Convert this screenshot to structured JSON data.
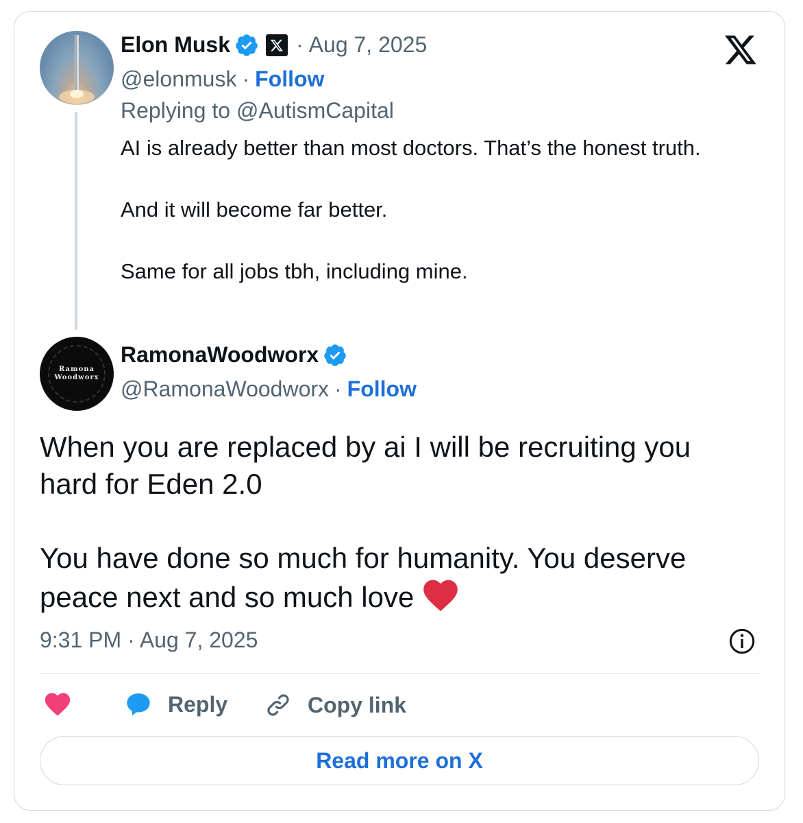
{
  "colors": {
    "link": "#1d6fd8",
    "muted": "#536471",
    "text": "#0f1419",
    "border": "#cfd9de",
    "heart": "#f0407a",
    "verified": "#1d9bf0"
  },
  "parent_tweet": {
    "display_name": "Elon Musk",
    "verified_icon": "verified-badge-icon",
    "affiliate_icon": "x-affiliate-icon",
    "separator": "·",
    "date": "Aug 7, 2025",
    "handle": "@elonmusk",
    "handle_sep": "·",
    "follow_label": "Follow",
    "replying_to": "Replying to @AutismCapital",
    "paragraphs": [
      "AI is already better than most doctors. That’s the honest truth.",
      "And it will become far better.",
      "Same for all jobs tbh, including mine."
    ]
  },
  "brand_icon": "x-logo-icon",
  "reply_tweet": {
    "display_name": "RamonaWoodworx",
    "verified_icon": "verified-badge-icon",
    "handle": "@RamonaWoodworx",
    "handle_sep": "·",
    "follow_label": "Follow",
    "avatar_text": [
      "Ramona",
      "Woodworx"
    ],
    "paragraphs": [
      "When you are replaced by ai I will be recruiting you hard for Eden 2.0",
      "You have done so much for humanity. You deserve peace next and so much love"
    ],
    "emoji": "red-heart-emoji",
    "timestamp": "9:31 PM · Aug 7, 2025",
    "info_icon": "info-icon"
  },
  "actions": {
    "like_icon": "heart-icon",
    "reply_icon": "speech-bubble-icon",
    "reply_label": "Reply",
    "copy_icon": "link-icon",
    "copy_label": "Copy link"
  },
  "read_more_label": "Read more on X"
}
